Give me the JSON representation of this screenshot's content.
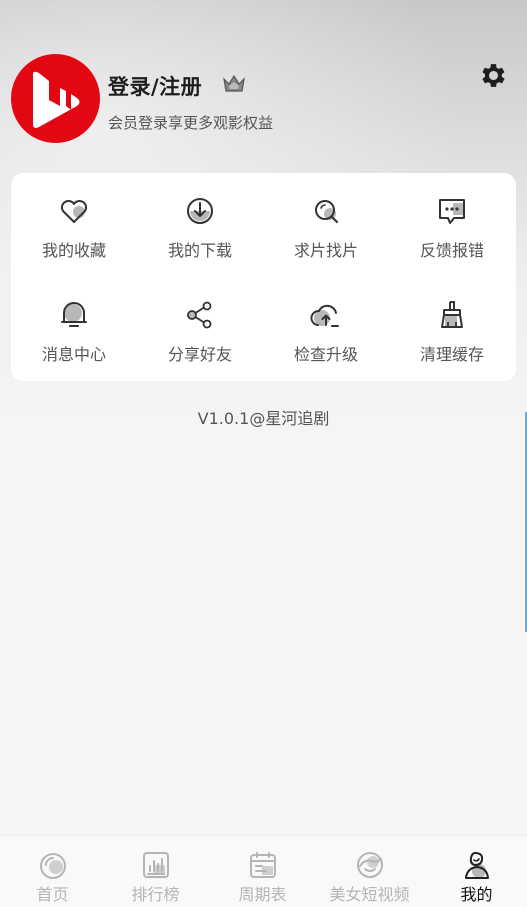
{
  "profile": {
    "title": "登录/注册",
    "subtitle": "会员登录享更多观影权益"
  },
  "menu": [
    {
      "label": "我的收藏",
      "icon": "heart-icon"
    },
    {
      "label": "我的下载",
      "icon": "download-icon"
    },
    {
      "label": "求片找片",
      "icon": "search-icon"
    },
    {
      "label": "反馈报错",
      "icon": "feedback-icon"
    },
    {
      "label": "消息中心",
      "icon": "bell-icon"
    },
    {
      "label": "分享好友",
      "icon": "share-icon"
    },
    {
      "label": "检查升级",
      "icon": "upgrade-icon"
    },
    {
      "label": "清理缓存",
      "icon": "broom-icon"
    }
  ],
  "version": "V1.0.1@星河追剧",
  "tabs": [
    {
      "label": "首页",
      "icon": "home-icon",
      "active": false
    },
    {
      "label": "排行榜",
      "icon": "ranking-icon",
      "active": false
    },
    {
      "label": "周期表",
      "icon": "calendar-icon",
      "active": false
    },
    {
      "label": "美女短视频",
      "icon": "short-video-icon",
      "active": false
    },
    {
      "label": "我的",
      "icon": "profile-icon",
      "active": true
    }
  ],
  "colors": {
    "brand": "#e30613",
    "active_tab": "#111111",
    "inactive_tab": "#b5b5b5"
  }
}
